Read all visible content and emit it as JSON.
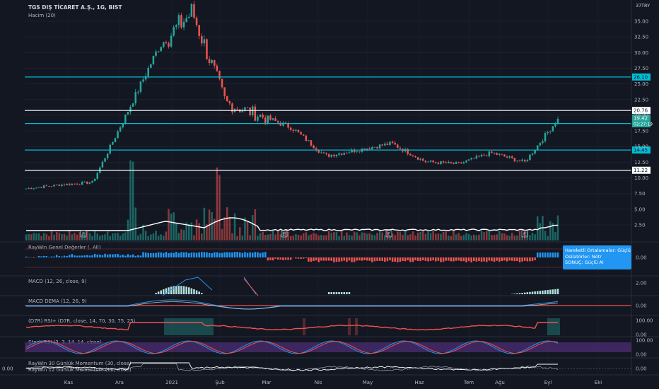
{
  "header": {
    "symbol_title": "TGS DIŞ TİCARET A.Ş., 1G, BIST",
    "volume_label": "Hacim (20)",
    "currency": "TRY"
  },
  "signal_box": {
    "line1": "Hareketli Ortalamalar:     Güçlü",
    "line2": "Osilatörler:  Nötr",
    "line3": "SONUÇ:    Güçlü Al"
  },
  "panes": [
    {
      "key": "raywin",
      "title": "RayWin Genel Değerler (, All)",
      "ticks": [
        "0.00"
      ]
    },
    {
      "key": "macd",
      "title": "MACD (12, 26, close, 9)",
      "ticks": [
        "2.00"
      ]
    },
    {
      "key": "macd_dema",
      "title": "MACD DEMA (12, 26, 9)",
      "ticks": [
        "0.00"
      ]
    },
    {
      "key": "d7r",
      "title": "(D7R) RSI+ (D7R, close, 14, 70, 30, 75, 25)",
      "ticks": [
        "100.00",
        "0.00"
      ]
    },
    {
      "key": "stoch",
      "title": "Stoch RSI (3, 3, 14, 14, close)",
      "ticks": [
        "100.00",
        "0.00"
      ]
    },
    {
      "key": "momentum",
      "title": "RayWin 30 Günlük Momentum (30, close)",
      "title2": "RayWin 12 Günlük Momentum (12, close)",
      "ticks": [
        "0.00"
      ],
      "left_tick": "0.00"
    }
  ],
  "colors": {
    "background": "#131722",
    "up": "#26a69a",
    "down": "#ef5350",
    "cyan_line": "#00bcd4",
    "white_line": "#ffffff",
    "blue_bar": "#2196f3",
    "purple_band": "#4a2c6e"
  },
  "chart_data": {
    "type": "candlestick",
    "title": "TGS DIŞ TİCARET A.Ş., 1G, BIST",
    "y_ticks": [
      35.0,
      32.5,
      30.0,
      27.5,
      25.0,
      22.5,
      20.0,
      17.5,
      15.0,
      12.5,
      10.0,
      7.5,
      5.0,
      2.5
    ],
    "ylim": [
      2.5,
      37.5
    ],
    "x_ticks": [
      "Kas",
      "Ara",
      "2021",
      "Şub",
      "Mar",
      "Nis",
      "May",
      "Haz",
      "Tem",
      "Ağu",
      "Eyl",
      "Eki"
    ],
    "top_right_tick": "37",
    "price_trend": [
      {
        "month": "Kas",
        "close": 8.3
      },
      {
        "month": "Ara",
        "close": 8.9
      },
      {
        "month": "2021",
        "close": 9.3
      },
      {
        "month": "2021+",
        "close": 20.0
      },
      {
        "month": "Şub",
        "close": 31.0
      },
      {
        "month": "Şub+",
        "close": 36.5
      },
      {
        "month": "Mar",
        "close": 22.0
      },
      {
        "month": "Mar+",
        "close": 20.0
      },
      {
        "month": "Nis",
        "close": 18.0
      },
      {
        "month": "Nis+",
        "close": 13.5
      },
      {
        "month": "May",
        "close": 14.5
      },
      {
        "month": "May+",
        "close": 15.5
      },
      {
        "month": "Haz",
        "close": 12.6
      },
      {
        "month": "Tem",
        "close": 12.2
      },
      {
        "month": "Ağu",
        "close": 14.0
      },
      {
        "month": "Ağu+",
        "close": 12.5
      },
      {
        "month": "Eyl",
        "close": 19.42
      }
    ],
    "horizontal_levels": [
      {
        "value": 26.1,
        "color": "cyan",
        "label": "26.10"
      },
      {
        "value": 20.76,
        "color": "white",
        "label": "20.76"
      },
      {
        "value": 18.68,
        "color": "cyan",
        "label": "18.68"
      },
      {
        "value": 14.45,
        "color": "cyan",
        "label": "14.45"
      },
      {
        "value": 11.22,
        "color": "white",
        "label": "11.22"
      }
    ],
    "last_price": {
      "value": 19.42,
      "label": "19.42",
      "countdown": "02:27:19"
    },
    "earnings_markers": [
      "E",
      "E",
      "E",
      "E"
    ]
  }
}
